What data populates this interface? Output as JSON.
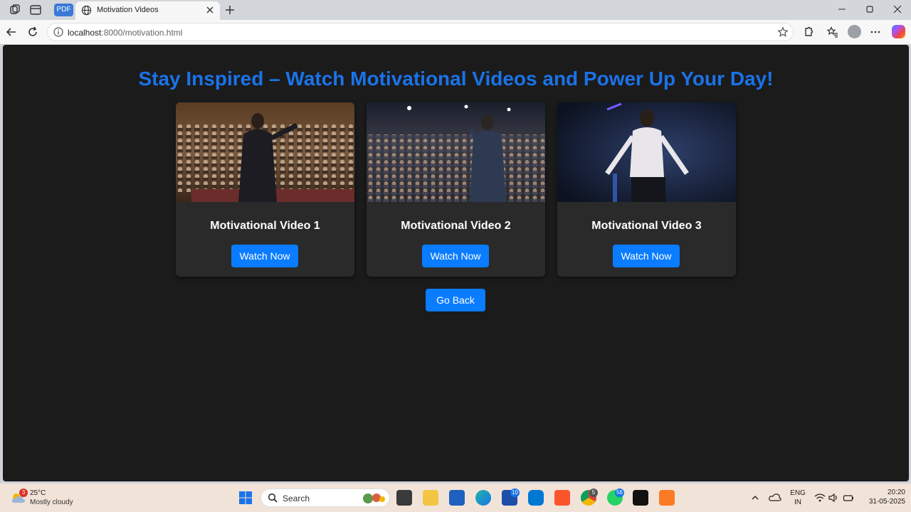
{
  "browser": {
    "pdf_chip": "PDF",
    "tab_title": "Motivation Videos",
    "url_host": "localhost",
    "url_rest": ":8000/motivation.html"
  },
  "page": {
    "heading": "Stay Inspired – Watch Motivational Videos and Power Up Your Day!",
    "videos": [
      {
        "title": "Motivational Video 1",
        "button": "Watch Now"
      },
      {
        "title": "Motivational Video 2",
        "button": "Watch Now"
      },
      {
        "title": "Motivational Video 3",
        "button": "Watch Now"
      }
    ],
    "go_back": "Go Back",
    "colors": {
      "heading": "#1a73e8",
      "button": "#0a7cff",
      "background": "#1b1b1c",
      "card": "#2a2a2b"
    }
  },
  "taskbar": {
    "weather_badge": "3",
    "temperature": "25°C",
    "condition": "Mostly cloudy",
    "search_label": "Search",
    "badges": {
      "lens": "10",
      "chrome": "5",
      "whatsapp": "56"
    },
    "language": "ENG",
    "region": "IN",
    "time": "20:20",
    "date": "31-05-2025"
  }
}
